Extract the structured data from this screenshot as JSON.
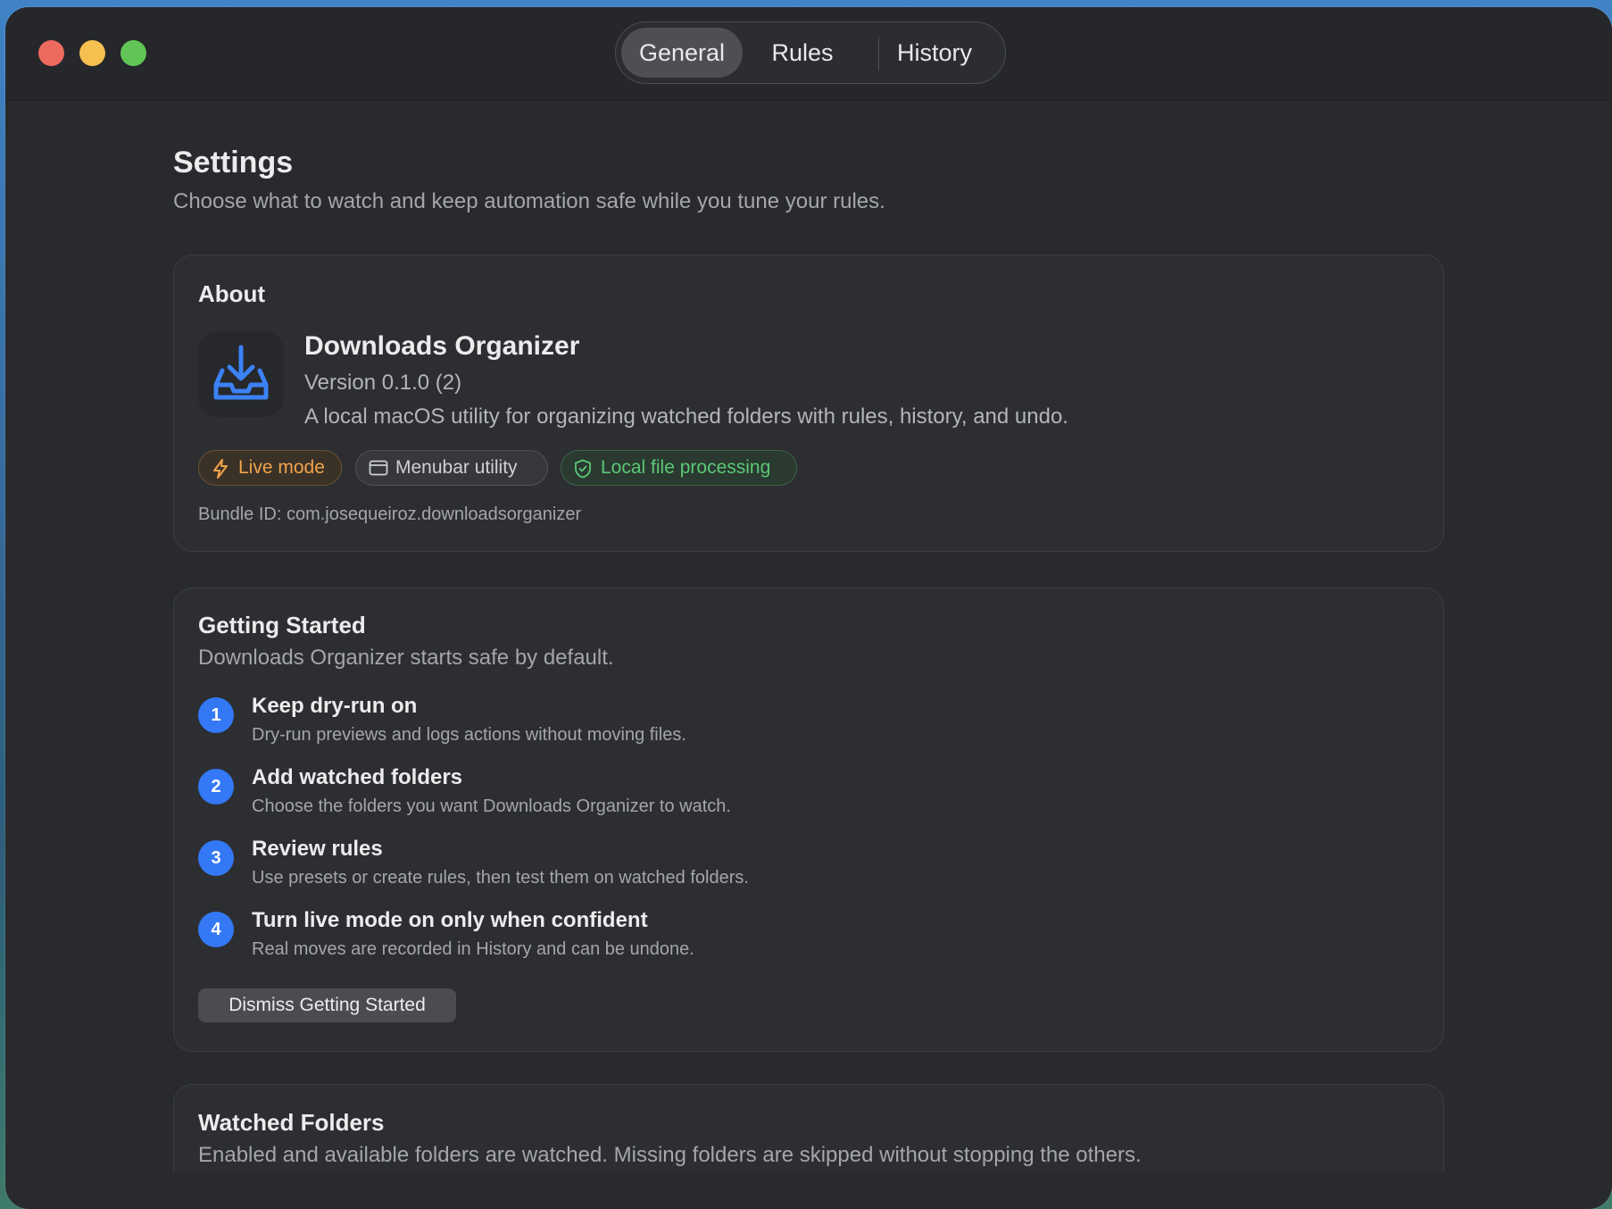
{
  "tabs": {
    "general": "General",
    "rules": "Rules",
    "history": "History"
  },
  "page": {
    "title": "Settings",
    "subtitle": "Choose what to watch and keep automation safe while you tune your rules."
  },
  "about": {
    "title": "About",
    "app_name": "Downloads Organizer",
    "version": "Version 0.1.0 (2)",
    "description": "A local macOS utility for organizing watched folders with rules, history, and undo.",
    "badges": {
      "live_mode": "Live mode",
      "menubar": "Menubar utility",
      "local": "Local file processing"
    },
    "bundle_id": "Bundle ID: com.josequeiroz.downloadsorganizer"
  },
  "getting_started": {
    "title": "Getting Started",
    "subtitle": "Downloads Organizer starts safe by default.",
    "steps": [
      {
        "num": "1",
        "title": "Keep dry-run on",
        "desc": "Dry-run previews and logs actions without moving files."
      },
      {
        "num": "2",
        "title": "Add watched folders",
        "desc": "Choose the folders you want Downloads Organizer to watch."
      },
      {
        "num": "3",
        "title": "Review rules",
        "desc": "Use presets or create rules, then test them on watched folders."
      },
      {
        "num": "4",
        "title": "Turn live mode on only when confident",
        "desc": "Real moves are recorded in History and can be undone."
      }
    ],
    "dismiss_label": "Dismiss Getting Started"
  },
  "watched_folders": {
    "title": "Watched Folders",
    "subtitle": "Enabled and available folders are watched. Missing folders are skipped without stopping the others."
  },
  "colors": {
    "accent": "#3478f6",
    "live_mode": "#f0a44b",
    "local": "#5cc777",
    "window_bg": "#282a2e"
  },
  "icons": {
    "app": "tray-arrow-down-icon",
    "live_mode": "bolt-icon",
    "menubar": "window-icon",
    "local": "shield-check-icon"
  }
}
